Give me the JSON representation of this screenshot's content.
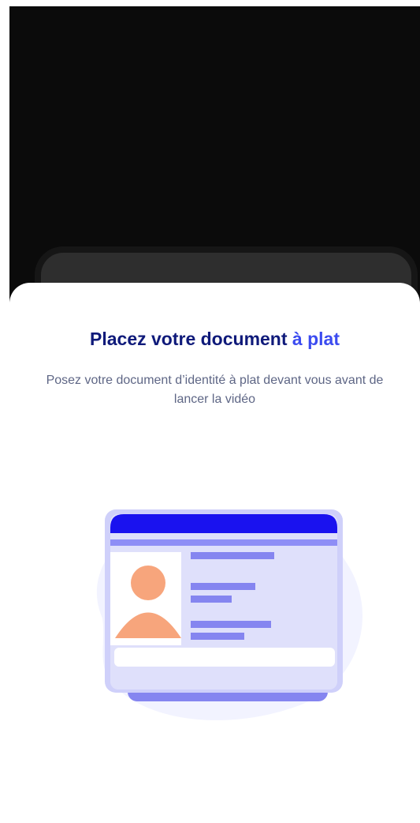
{
  "camera": {
    "state": "dark-preview"
  },
  "sheet": {
    "title_main": "Placez votre document ",
    "title_accent": "à plat",
    "description": "Posez votre document d’identité à plat devant vous avant de lancer la vidéo"
  },
  "illustration": {
    "icon": "id-card-icon",
    "colors": {
      "header": "#1a12ef",
      "stripe": "#8e8ef6",
      "card_body": "#dfe0fb",
      "avatar": "#f7a57c",
      "blob": "#f2f3ff",
      "back_card": "#8585f0"
    }
  },
  "colors": {
    "title": "#0f1a7a",
    "title_accent": "#3b4bf0",
    "description": "#5e6685"
  }
}
